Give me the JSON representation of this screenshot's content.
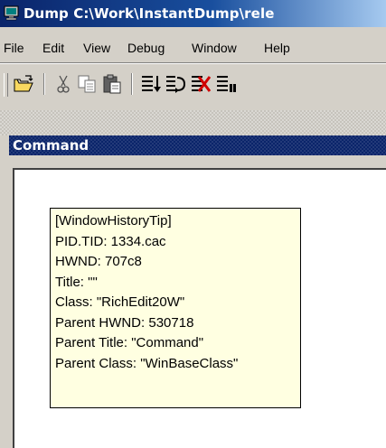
{
  "window": {
    "title": "Dump C:\\Work\\InstantDump\\rele"
  },
  "menu": {
    "items": [
      {
        "label": "File"
      },
      {
        "label": "Edit"
      },
      {
        "label": "View"
      },
      {
        "label": "Debug"
      },
      {
        "label": "Window"
      },
      {
        "label": "Help"
      }
    ]
  },
  "toolbar": {
    "buttons": [
      {
        "icon": "open-folder-icon"
      },
      {
        "icon": "cut-icon"
      },
      {
        "icon": "copy-icon"
      },
      {
        "icon": "paste-icon"
      },
      {
        "icon": "step-into-icon"
      },
      {
        "icon": "step-over-icon"
      },
      {
        "icon": "stop-debugging-icon"
      },
      {
        "icon": "break-icon"
      }
    ]
  },
  "panel": {
    "title": "Command"
  },
  "tooltip": {
    "lines": [
      "[WindowHistoryTip]",
      "PID.TID: 1334.cac",
      "HWND: 707c8",
      "Title: \"\"",
      "Class: \"RichEdit20W\"",
      "Parent HWND: 530718",
      "Parent Title: \"Command\"",
      "Parent Class: \"WinBaseClass\""
    ]
  },
  "colors": {
    "titlebar_start": "#0a246a",
    "titlebar_end": "#a6caf0",
    "face": "#d4d0c8",
    "tooltip_bg": "#ffffe1",
    "panel_header": "#0a246a"
  }
}
